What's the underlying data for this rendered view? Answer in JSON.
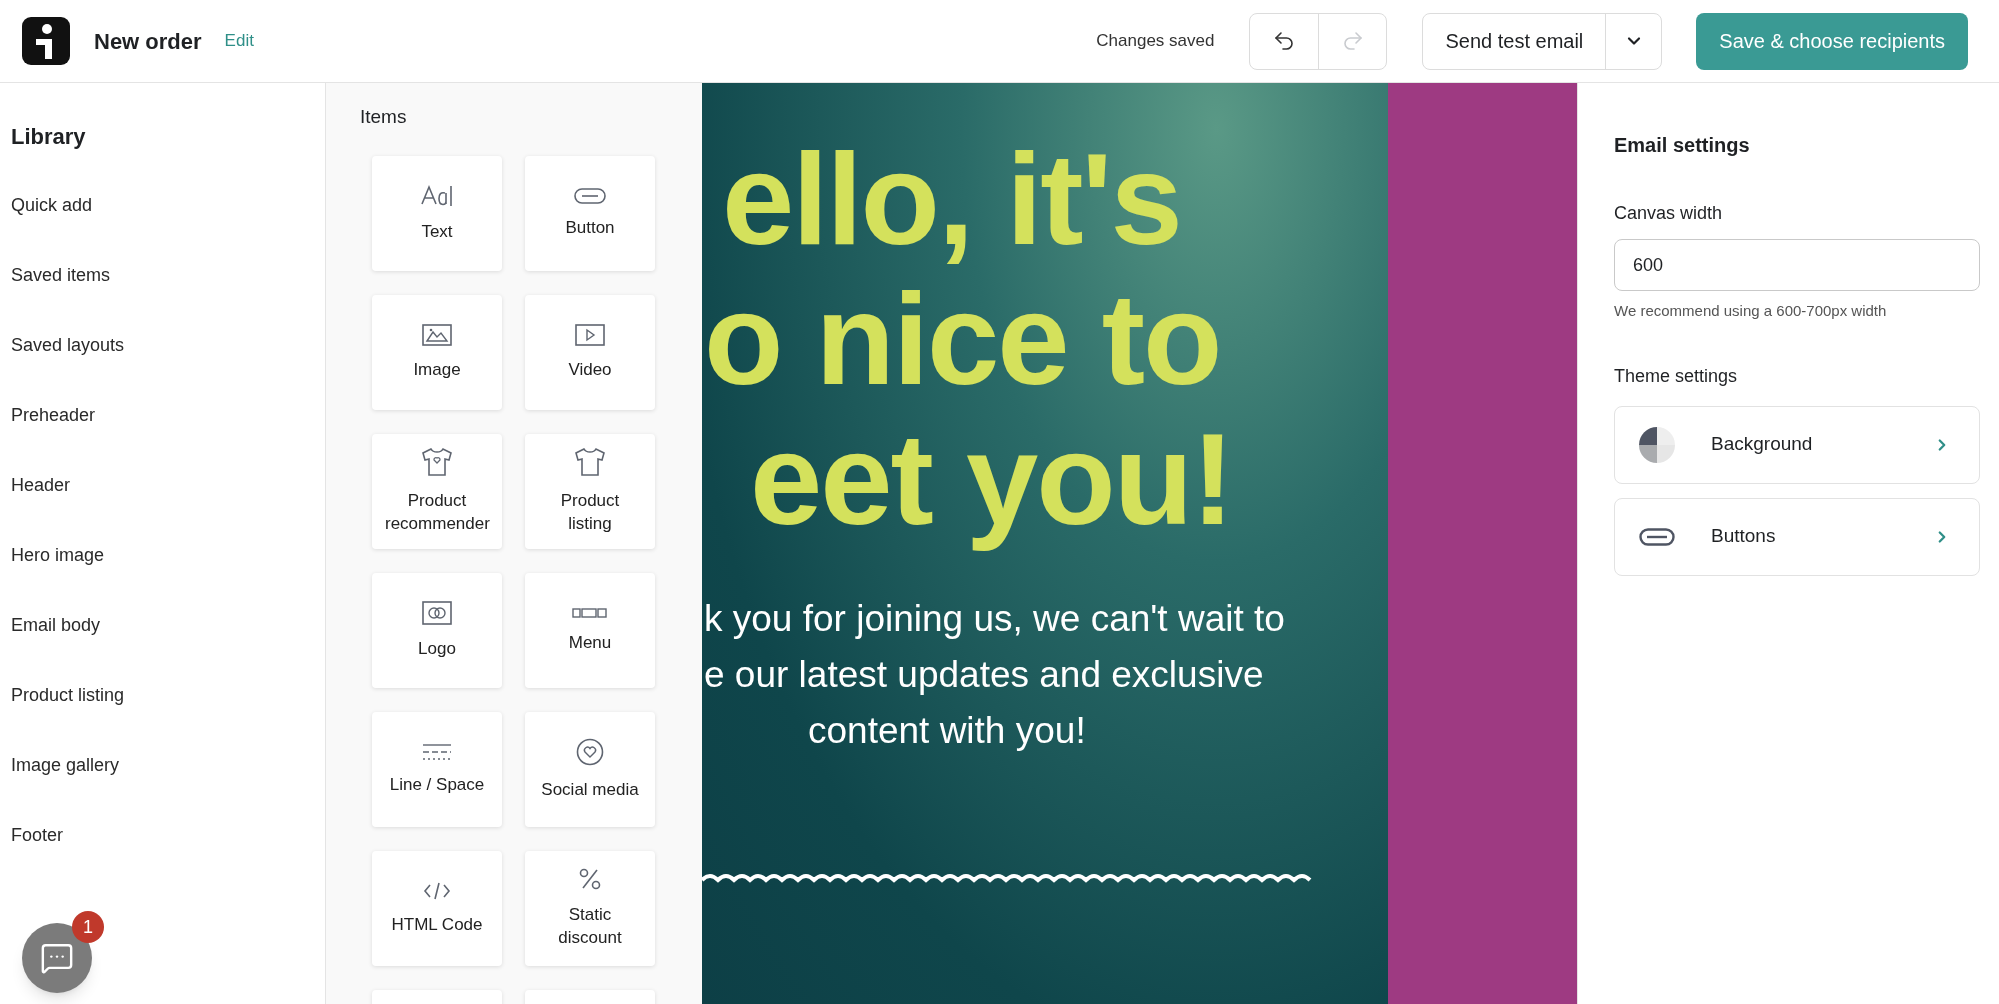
{
  "header": {
    "title": "New order",
    "edit_link": "Edit",
    "status": "Changes saved",
    "history": [
      {
        "kind": "undo",
        "disabled": false
      },
      {
        "kind": "redo",
        "disabled": true
      }
    ],
    "test_button": "Send test email",
    "save_button": "Save & choose recipients"
  },
  "library": {
    "title": "Library",
    "items": [
      "Quick add",
      "Saved items",
      "Saved layouts",
      "Preheader",
      "Header",
      "Hero image",
      "Email body",
      "Product listing",
      "Image gallery",
      "Footer"
    ]
  },
  "items_panel": {
    "title": "Items",
    "items": [
      "Text",
      "Button",
      "Image",
      "Video",
      "Product recommender",
      "Product listing",
      "Logo",
      "Menu",
      "Line / Space",
      "Social media",
      "HTML Code",
      "Static discount"
    ]
  },
  "email": {
    "hero_lines": [
      "ello, it's",
      "o nice to",
      "eet you!"
    ],
    "body_lines": [
      "k you for joining us, we can't wait to",
      "e our latest updates and exclusive",
      "content with you!"
    ]
  },
  "settings": {
    "title": "Email settings",
    "canvas_width": {
      "label": "Canvas width",
      "value": "600",
      "hint": "We recommend using a 600-700px width"
    },
    "theme_title": "Theme settings",
    "theme_items": [
      "Background",
      "Buttons"
    ]
  },
  "chat": {
    "badge": "1"
  }
}
